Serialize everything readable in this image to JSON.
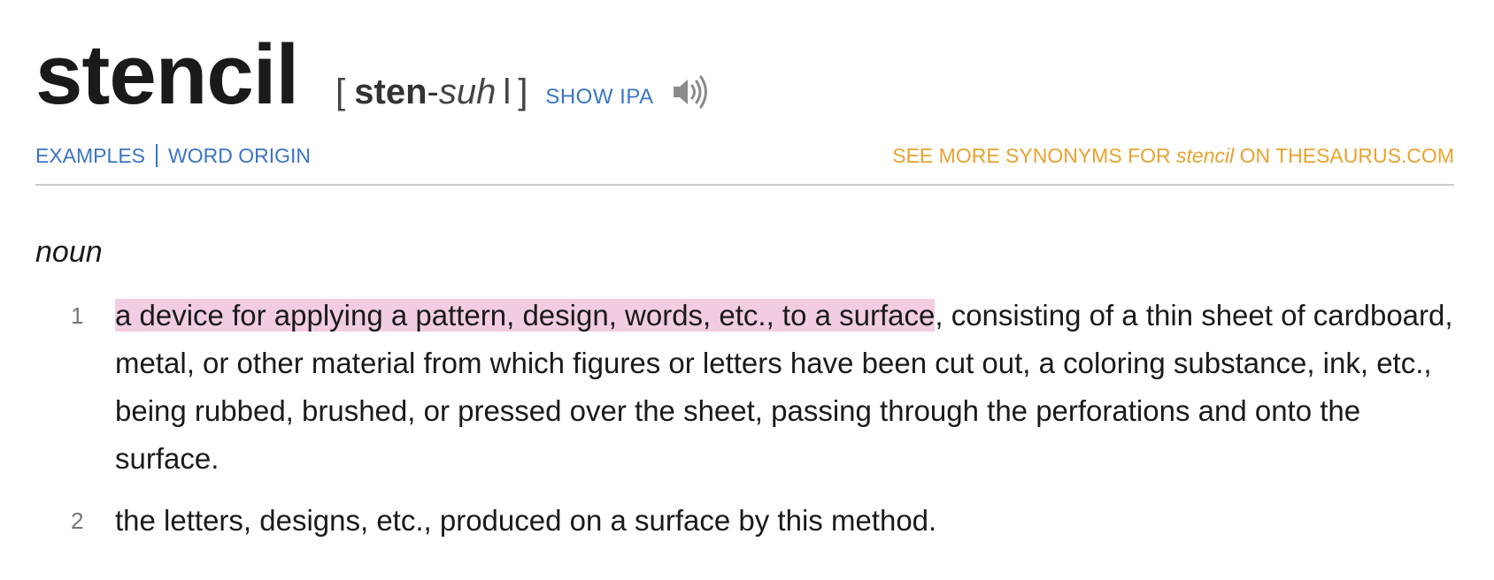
{
  "entry": {
    "headword": "stencil",
    "pronunciation": {
      "open_bracket": "[",
      "stressed": "sten",
      "dash": "-",
      "unstressed": "suh",
      "bar": "l",
      "close_bracket": "]"
    },
    "show_ipa_label": "SHOW IPA",
    "speaker_icon": "speaker-icon"
  },
  "tabs": {
    "examples_label": "EXAMPLES",
    "word_origin_label": "WORD ORIGIN"
  },
  "synonyms_link": {
    "prefix": "SEE MORE SYNONYMS FOR ",
    "word": "stencil",
    "suffix": " ON THESAURUS.COM"
  },
  "colors": {
    "link_blue": "#3a75c4",
    "synonyms_orange": "#e8a230",
    "highlight_pink": "#f2cde2"
  },
  "part_of_speech": "noun",
  "definitions": [
    {
      "number": "1",
      "highlighted": "a device for applying a pattern, design, words, etc., to a surface",
      "rest": ", consisting of a thin sheet of cardboard, metal, or other material from which figures or letters have been cut out, a coloring substance, ink, etc., being rubbed, brushed, or pressed over the sheet, passing through the perforations and onto the surface."
    },
    {
      "number": "2",
      "highlighted": "",
      "rest": "the letters, designs, etc., produced on a surface by this method."
    }
  ]
}
